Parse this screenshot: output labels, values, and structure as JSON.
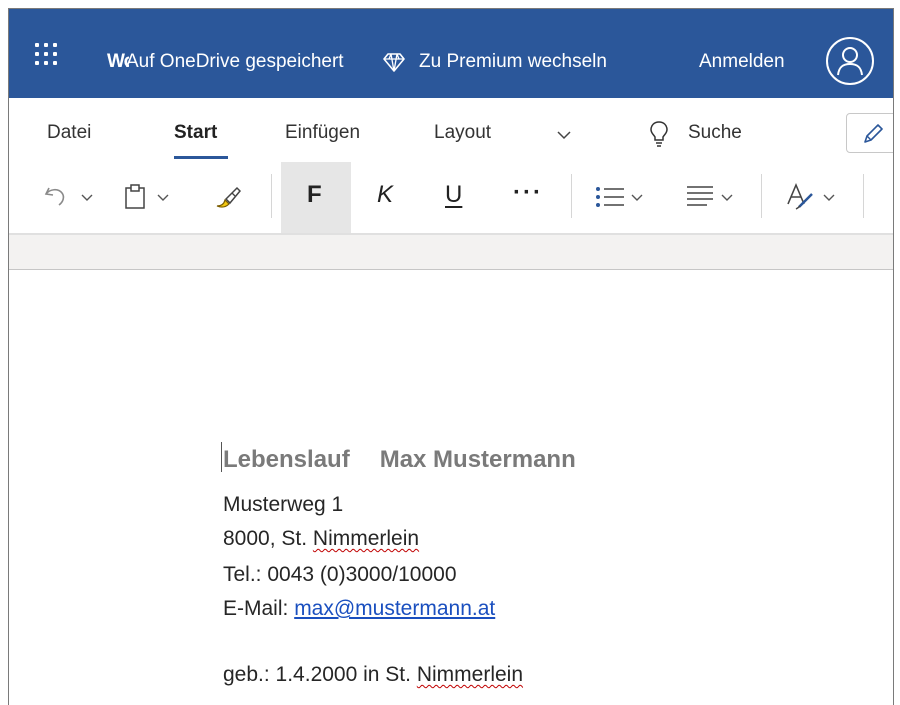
{
  "titlebar": {
    "app_name": "Word",
    "save_status": "Auf OneDrive gespeichert",
    "premium_label": "Zu Premium wechseln",
    "signin_label": "Anmelden",
    "bg_color": "#2b579a"
  },
  "ribbon": {
    "tabs": [
      {
        "label": "Datei"
      },
      {
        "label": "Start",
        "active": true
      },
      {
        "label": "Einfügen"
      },
      {
        "label": "Layout"
      }
    ],
    "search_label": "Suche",
    "format": {
      "bold": "F",
      "italic": "K",
      "underline": "U",
      "more": "···"
    }
  },
  "document": {
    "title_prefix": "Lebenslauf",
    "title_name": "Max Mustermann",
    "street": "Musterweg 1",
    "city_prefix": "8000, St.",
    "city_name": "Nimmerlein",
    "phone": "Tel.: 0043 (0)3000/10000",
    "email_label": "E-Mail:",
    "email": "max@mustermann.at",
    "birth_prefix": "geb.: 1.4.2000 in St.",
    "birth_place": "Nimmerlein"
  }
}
